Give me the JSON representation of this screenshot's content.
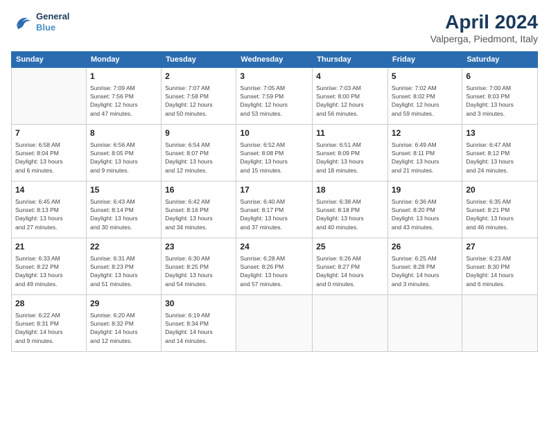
{
  "header": {
    "logo_line1": "General",
    "logo_line2": "Blue",
    "title": "April 2024",
    "location": "Valperga, Piedmont, Italy"
  },
  "calendar": {
    "days_of_week": [
      "Sunday",
      "Monday",
      "Tuesday",
      "Wednesday",
      "Thursday",
      "Friday",
      "Saturday"
    ],
    "weeks": [
      [
        {
          "day": "",
          "info": ""
        },
        {
          "day": "1",
          "info": "Sunrise: 7:09 AM\nSunset: 7:56 PM\nDaylight: 12 hours\nand 47 minutes."
        },
        {
          "day": "2",
          "info": "Sunrise: 7:07 AM\nSunset: 7:58 PM\nDaylight: 12 hours\nand 50 minutes."
        },
        {
          "day": "3",
          "info": "Sunrise: 7:05 AM\nSunset: 7:59 PM\nDaylight: 12 hours\nand 53 minutes."
        },
        {
          "day": "4",
          "info": "Sunrise: 7:03 AM\nSunset: 8:00 PM\nDaylight: 12 hours\nand 56 minutes."
        },
        {
          "day": "5",
          "info": "Sunrise: 7:02 AM\nSunset: 8:02 PM\nDaylight: 12 hours\nand 59 minutes."
        },
        {
          "day": "6",
          "info": "Sunrise: 7:00 AM\nSunset: 8:03 PM\nDaylight: 13 hours\nand 3 minutes."
        }
      ],
      [
        {
          "day": "7",
          "info": "Sunrise: 6:58 AM\nSunset: 8:04 PM\nDaylight: 13 hours\nand 6 minutes."
        },
        {
          "day": "8",
          "info": "Sunrise: 6:56 AM\nSunset: 8:05 PM\nDaylight: 13 hours\nand 9 minutes."
        },
        {
          "day": "9",
          "info": "Sunrise: 6:54 AM\nSunset: 8:07 PM\nDaylight: 13 hours\nand 12 minutes."
        },
        {
          "day": "10",
          "info": "Sunrise: 6:52 AM\nSunset: 8:08 PM\nDaylight: 13 hours\nand 15 minutes."
        },
        {
          "day": "11",
          "info": "Sunrise: 6:51 AM\nSunset: 8:09 PM\nDaylight: 13 hours\nand 18 minutes."
        },
        {
          "day": "12",
          "info": "Sunrise: 6:49 AM\nSunset: 8:11 PM\nDaylight: 13 hours\nand 21 minutes."
        },
        {
          "day": "13",
          "info": "Sunrise: 6:47 AM\nSunset: 8:12 PM\nDaylight: 13 hours\nand 24 minutes."
        }
      ],
      [
        {
          "day": "14",
          "info": "Sunrise: 6:45 AM\nSunset: 8:13 PM\nDaylight: 13 hours\nand 27 minutes."
        },
        {
          "day": "15",
          "info": "Sunrise: 6:43 AM\nSunset: 8:14 PM\nDaylight: 13 hours\nand 30 minutes."
        },
        {
          "day": "16",
          "info": "Sunrise: 6:42 AM\nSunset: 8:16 PM\nDaylight: 13 hours\nand 34 minutes."
        },
        {
          "day": "17",
          "info": "Sunrise: 6:40 AM\nSunset: 8:17 PM\nDaylight: 13 hours\nand 37 minutes."
        },
        {
          "day": "18",
          "info": "Sunrise: 6:38 AM\nSunset: 8:18 PM\nDaylight: 13 hours\nand 40 minutes."
        },
        {
          "day": "19",
          "info": "Sunrise: 6:36 AM\nSunset: 8:20 PM\nDaylight: 13 hours\nand 43 minutes."
        },
        {
          "day": "20",
          "info": "Sunrise: 6:35 AM\nSunset: 8:21 PM\nDaylight: 13 hours\nand 46 minutes."
        }
      ],
      [
        {
          "day": "21",
          "info": "Sunrise: 6:33 AM\nSunset: 8:22 PM\nDaylight: 13 hours\nand 49 minutes."
        },
        {
          "day": "22",
          "info": "Sunrise: 6:31 AM\nSunset: 8:23 PM\nDaylight: 13 hours\nand 51 minutes."
        },
        {
          "day": "23",
          "info": "Sunrise: 6:30 AM\nSunset: 8:25 PM\nDaylight: 13 hours\nand 54 minutes."
        },
        {
          "day": "24",
          "info": "Sunrise: 6:28 AM\nSunset: 8:26 PM\nDaylight: 13 hours\nand 57 minutes."
        },
        {
          "day": "25",
          "info": "Sunrise: 6:26 AM\nSunset: 8:27 PM\nDaylight: 14 hours\nand 0 minutes."
        },
        {
          "day": "26",
          "info": "Sunrise: 6:25 AM\nSunset: 8:28 PM\nDaylight: 14 hours\nand 3 minutes."
        },
        {
          "day": "27",
          "info": "Sunrise: 6:23 AM\nSunset: 8:30 PM\nDaylight: 14 hours\nand 6 minutes."
        }
      ],
      [
        {
          "day": "28",
          "info": "Sunrise: 6:22 AM\nSunset: 8:31 PM\nDaylight: 14 hours\nand 9 minutes."
        },
        {
          "day": "29",
          "info": "Sunrise: 6:20 AM\nSunset: 8:32 PM\nDaylight: 14 hours\nand 12 minutes."
        },
        {
          "day": "30",
          "info": "Sunrise: 6:19 AM\nSunset: 8:34 PM\nDaylight: 14 hours\nand 14 minutes."
        },
        {
          "day": "",
          "info": ""
        },
        {
          "day": "",
          "info": ""
        },
        {
          "day": "",
          "info": ""
        },
        {
          "day": "",
          "info": ""
        }
      ]
    ]
  }
}
